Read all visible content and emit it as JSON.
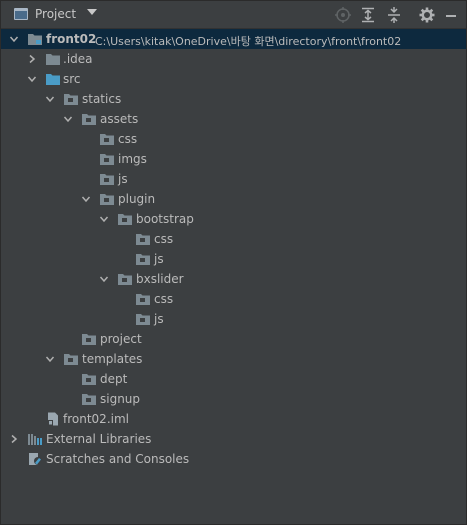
{
  "toolbar": {
    "title": "Project",
    "icons": [
      "locate-icon",
      "expand-all-icon",
      "collapse-all-icon",
      "settings-gear-icon",
      "hide-icon"
    ]
  },
  "colors": {
    "background": "#3c3f41",
    "selection": "#0d293e",
    "folder": "#7d8a92",
    "source_folder": "#4a9cc7",
    "text": "#bbbbbb"
  },
  "tree": {
    "root": {
      "name": "front02",
      "path": "C:\\Users\\kitak\\OneDrive\\바탕 화면\\directory\\front\\front02"
    },
    "idea": ".idea",
    "src": "src",
    "statics": "statics",
    "assets": "assets",
    "assets_css": "css",
    "assets_imgs": "imgs",
    "assets_js": "js",
    "plugin": "plugin",
    "bootstrap": "bootstrap",
    "bootstrap_css": "css",
    "bootstrap_js": "js",
    "bxslider": "bxslider",
    "bxslider_css": "css",
    "bxslider_js": "js",
    "project": "project",
    "templates": "templates",
    "dept": "dept",
    "signup": "signup",
    "iml": "front02.iml",
    "external_libraries": "External Libraries",
    "scratches": "Scratches and Consoles"
  }
}
